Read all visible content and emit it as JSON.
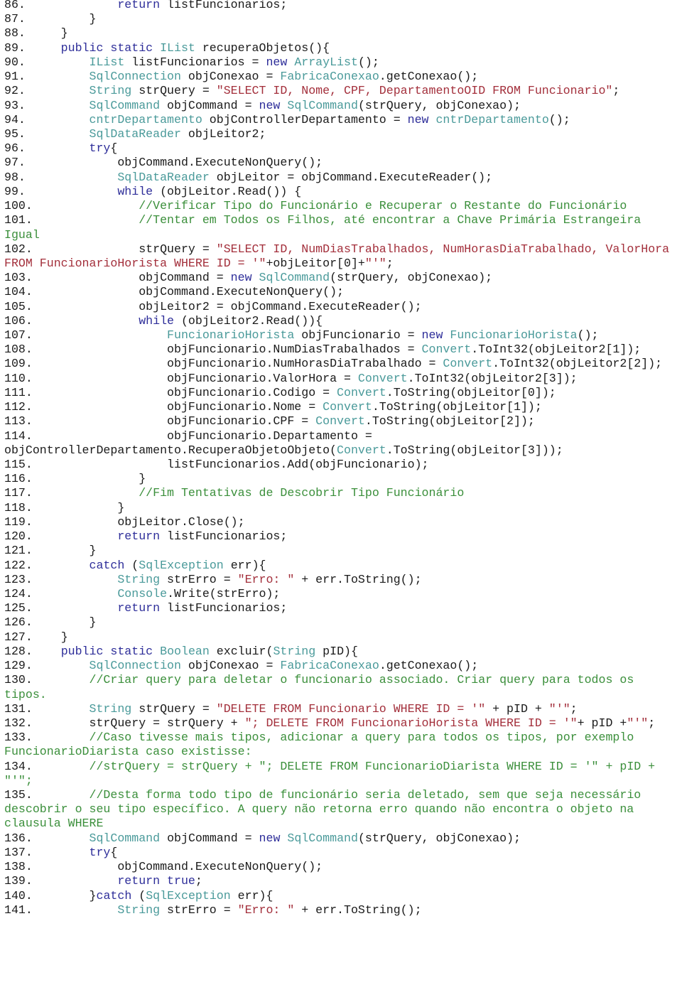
{
  "document": {
    "kind": "code-listing",
    "language": "C#",
    "token_colors": {
      "keyword": "#2d2d99",
      "type": "#4a9a9a",
      "string": "#a32f3b",
      "comment": "#3b8f3b",
      "plain": "#1a1a1a"
    },
    "lines": [
      {
        "n": "86.",
        "indent": 12,
        "tokens": [
          [
            "kw",
            "return"
          ],
          [
            "pl",
            " listFuncionarios;"
          ]
        ]
      },
      {
        "n": "87.",
        "indent": 8,
        "tokens": [
          [
            "pl",
            "}"
          ]
        ]
      },
      {
        "n": "88.",
        "indent": 4,
        "tokens": [
          [
            "pl",
            "}"
          ]
        ]
      },
      {
        "n": "89.",
        "indent": 4,
        "tokens": [
          [
            "kw",
            "public static"
          ],
          [
            "pl",
            " "
          ],
          [
            "ty",
            "IList"
          ],
          [
            "pl",
            " recuperaObjetos(){"
          ]
        ]
      },
      {
        "n": "90.",
        "indent": 8,
        "tokens": [
          [
            "ty",
            "IList"
          ],
          [
            "pl",
            " listFuncionarios = "
          ],
          [
            "kw",
            "new"
          ],
          [
            "pl",
            " "
          ],
          [
            "ty",
            "ArrayList"
          ],
          [
            "pl",
            "();"
          ]
        ]
      },
      {
        "n": "91.",
        "indent": 8,
        "tokens": [
          [
            "ty",
            "SqlConnection"
          ],
          [
            "pl",
            " objConexao = "
          ],
          [
            "ty",
            "FabricaConexao"
          ],
          [
            "pl",
            ".getConexao();"
          ]
        ]
      },
      {
        "n": "92.",
        "indent": 8,
        "tokens": [
          [
            "ty",
            "String"
          ],
          [
            "pl",
            " strQuery = "
          ],
          [
            "str",
            "\"SELECT ID, Nome, CPF, DepartamentoOID FROM Funcionario\""
          ],
          [
            "pl",
            ";"
          ]
        ]
      },
      {
        "n": "93.",
        "indent": 8,
        "tokens": [
          [
            "ty",
            "SqlCommand"
          ],
          [
            "pl",
            " objCommand = "
          ],
          [
            "kw",
            "new"
          ],
          [
            "pl",
            " "
          ],
          [
            "ty",
            "SqlCommand"
          ],
          [
            "pl",
            "(strQuery, objConexao);"
          ]
        ]
      },
      {
        "n": "94.",
        "indent": 8,
        "tokens": [
          [
            "ty",
            "cntrDepartamento"
          ],
          [
            "pl",
            " objControllerDepartamento = "
          ],
          [
            "kw",
            "new"
          ],
          [
            "pl",
            " "
          ],
          [
            "ty",
            "cntrDepartamento"
          ],
          [
            "pl",
            "();"
          ]
        ]
      },
      {
        "n": "95.",
        "indent": 8,
        "tokens": [
          [
            "ty",
            "SqlDataReader"
          ],
          [
            "pl",
            " objLeitor2;"
          ]
        ]
      },
      {
        "n": "96.",
        "indent": 8,
        "tokens": [
          [
            "kw",
            "try"
          ],
          [
            "pl",
            "{"
          ]
        ]
      },
      {
        "n": "97.",
        "indent": 12,
        "tokens": [
          [
            "pl",
            "objCommand.ExecuteNonQuery();"
          ]
        ]
      },
      {
        "n": "98.",
        "indent": 12,
        "tokens": [
          [
            "ty",
            "SqlDataReader"
          ],
          [
            "pl",
            " objLeitor = objCommand.ExecuteReader();"
          ]
        ]
      },
      {
        "n": "99.",
        "indent": 12,
        "tokens": [
          [
            "kw",
            "while"
          ],
          [
            "pl",
            " (objLeitor.Read()) {"
          ]
        ]
      },
      {
        "n": "100.",
        "indent": 15,
        "tokens": [
          [
            "cm",
            "//Verificar Tipo do Funcionário e Recuperar o Restante do Funcionário"
          ]
        ]
      },
      {
        "n": "101.",
        "indent": 15,
        "tokens": [
          [
            "cm",
            "//Tentar em Todos os Filhos, até encontrar a Chave Primária Estrangeira Igual"
          ]
        ]
      },
      {
        "n": "102.",
        "indent": 15,
        "tokens": [
          [
            "pl",
            "strQuery = "
          ],
          [
            "str",
            "\"SELECT ID, NumDiasTrabalhados, NumHorasDiaTrabalhado, ValorHora FROM FuncionarioHorista WHERE ID = '\""
          ],
          [
            "pl",
            "+objLeitor[0]+"
          ],
          [
            "str",
            "\"'\""
          ],
          [
            "pl",
            ";"
          ]
        ]
      },
      {
        "n": "103.",
        "indent": 15,
        "tokens": [
          [
            "pl",
            "objCommand = "
          ],
          [
            "kw",
            "new"
          ],
          [
            "pl",
            " "
          ],
          [
            "ty",
            "SqlCommand"
          ],
          [
            "pl",
            "(strQuery, objConexao);"
          ]
        ]
      },
      {
        "n": "104.",
        "indent": 15,
        "tokens": [
          [
            "pl",
            "objCommand.ExecuteNonQuery();"
          ]
        ]
      },
      {
        "n": "105.",
        "indent": 15,
        "tokens": [
          [
            "pl",
            "objLeitor2 = objCommand.ExecuteReader();"
          ]
        ]
      },
      {
        "n": "106.",
        "indent": 15,
        "tokens": [
          [
            "kw",
            "while"
          ],
          [
            "pl",
            " (objLeitor2.Read()){"
          ]
        ]
      },
      {
        "n": "107.",
        "indent": 19,
        "tokens": [
          [
            "ty",
            "FuncionarioHorista"
          ],
          [
            "pl",
            " objFuncionario = "
          ],
          [
            "kw",
            "new"
          ],
          [
            "pl",
            " "
          ],
          [
            "ty",
            "FuncionarioHorista"
          ],
          [
            "pl",
            "();"
          ]
        ]
      },
      {
        "n": "108.",
        "indent": 19,
        "tokens": [
          [
            "pl",
            "objFuncionario.NumDiasTrabalhados = "
          ],
          [
            "ty",
            "Convert"
          ],
          [
            "pl",
            ".ToInt32(objLeitor2[1]);"
          ]
        ]
      },
      {
        "n": "109.",
        "indent": 19,
        "tokens": [
          [
            "pl",
            "objFuncionario.NumHorasDiaTrabalhado = "
          ],
          [
            "ty",
            "Convert"
          ],
          [
            "pl",
            ".ToInt32(objLeitor2[2]);"
          ]
        ]
      },
      {
        "n": "110.",
        "indent": 19,
        "tokens": [
          [
            "pl",
            "objFuncionario.ValorHora = "
          ],
          [
            "ty",
            "Convert"
          ],
          [
            "pl",
            ".ToInt32(objLeitor2[3]);"
          ]
        ]
      },
      {
        "n": "111.",
        "indent": 19,
        "tokens": [
          [
            "pl",
            "objFuncionario.Codigo = "
          ],
          [
            "ty",
            "Convert"
          ],
          [
            "pl",
            ".ToString(objLeitor[0]);"
          ]
        ]
      },
      {
        "n": "112.",
        "indent": 19,
        "tokens": [
          [
            "pl",
            "objFuncionario.Nome = "
          ],
          [
            "ty",
            "Convert"
          ],
          [
            "pl",
            ".ToString(objLeitor[1]);"
          ]
        ]
      },
      {
        "n": "113.",
        "indent": 19,
        "tokens": [
          [
            "pl",
            "objFuncionario.CPF = "
          ],
          [
            "ty",
            "Convert"
          ],
          [
            "pl",
            ".ToString(objLeitor[2]);"
          ]
        ]
      },
      {
        "n": "114.",
        "indent": 19,
        "tokens": [
          [
            "pl",
            "objFuncionario.Departamento = objControllerDepartamento.RecuperaObjetoObjeto("
          ],
          [
            "ty",
            "Convert"
          ],
          [
            "pl",
            ".ToString(objLeitor[3]));"
          ]
        ]
      },
      {
        "n": "115.",
        "indent": 19,
        "tokens": [
          [
            "pl",
            "listFuncionarios.Add(objFuncionario);"
          ]
        ]
      },
      {
        "n": "116.",
        "indent": 15,
        "tokens": [
          [
            "pl",
            "}"
          ]
        ]
      },
      {
        "n": "117.",
        "indent": 15,
        "tokens": [
          [
            "cm",
            "//Fim Tentativas de Descobrir Tipo Funcionário"
          ]
        ]
      },
      {
        "n": "118.",
        "indent": 12,
        "tokens": [
          [
            "pl",
            "}"
          ]
        ]
      },
      {
        "n": "119.",
        "indent": 12,
        "tokens": [
          [
            "pl",
            "objLeitor.Close();"
          ]
        ]
      },
      {
        "n": "120.",
        "indent": 12,
        "tokens": [
          [
            "kw",
            "return"
          ],
          [
            "pl",
            " listFuncionarios;"
          ]
        ]
      },
      {
        "n": "121.",
        "indent": 8,
        "tokens": [
          [
            "pl",
            "}"
          ]
        ]
      },
      {
        "n": "122.",
        "indent": 8,
        "tokens": [
          [
            "kw",
            "catch"
          ],
          [
            "pl",
            " ("
          ],
          [
            "ty",
            "SqlException"
          ],
          [
            "pl",
            " err){"
          ]
        ]
      },
      {
        "n": "123.",
        "indent": 12,
        "tokens": [
          [
            "ty",
            "String"
          ],
          [
            "pl",
            " strErro = "
          ],
          [
            "str",
            "\"Erro: \""
          ],
          [
            "pl",
            " + err.ToString();"
          ]
        ]
      },
      {
        "n": "124.",
        "indent": 12,
        "tokens": [
          [
            "ty",
            "Console"
          ],
          [
            "pl",
            ".Write(strErro);"
          ]
        ]
      },
      {
        "n": "125.",
        "indent": 12,
        "tokens": [
          [
            "kw",
            "return"
          ],
          [
            "pl",
            " listFuncionarios;"
          ]
        ]
      },
      {
        "n": "126.",
        "indent": 8,
        "tokens": [
          [
            "pl",
            "}"
          ]
        ]
      },
      {
        "n": "127.",
        "indent": 4,
        "tokens": [
          [
            "pl",
            "}"
          ]
        ]
      },
      {
        "n": "128.",
        "indent": 4,
        "tokens": [
          [
            "kw",
            "public static"
          ],
          [
            "pl",
            " "
          ],
          [
            "ty",
            "Boolean"
          ],
          [
            "pl",
            " excluir("
          ],
          [
            "ty",
            "String"
          ],
          [
            "pl",
            " pID){"
          ]
        ]
      },
      {
        "n": "129.",
        "indent": 8,
        "tokens": [
          [
            "ty",
            "SqlConnection"
          ],
          [
            "pl",
            " objConexao = "
          ],
          [
            "ty",
            "FabricaConexao"
          ],
          [
            "pl",
            ".getConexao();"
          ]
        ]
      },
      {
        "n": "130.",
        "indent": 8,
        "tokens": [
          [
            "cm",
            "//Criar query para deletar o funcionario associado. Criar query para todos os tipos."
          ]
        ]
      },
      {
        "n": "131.",
        "indent": 8,
        "tokens": [
          [
            "ty",
            "String"
          ],
          [
            "pl",
            " strQuery = "
          ],
          [
            "str",
            "\"DELETE FROM Funcionario WHERE ID = '\""
          ],
          [
            "pl",
            " + pID + "
          ],
          [
            "str",
            "\"'\""
          ],
          [
            "pl",
            ";"
          ]
        ]
      },
      {
        "n": "132.",
        "indent": 8,
        "tokens": [
          [
            "pl",
            "strQuery = strQuery + "
          ],
          [
            "str",
            "\"; DELETE FROM FuncionarioHorista WHERE ID = '\""
          ],
          [
            "pl",
            "+ pID +"
          ],
          [
            "str",
            "\"'\""
          ],
          [
            "pl",
            ";"
          ]
        ]
      },
      {
        "n": "133.",
        "indent": 8,
        "tokens": [
          [
            "cm",
            "//Caso tivesse mais tipos, adicionar a query para todos os tipos, por exemplo FuncionarioDiarista caso existisse:"
          ]
        ]
      },
      {
        "n": "134.",
        "indent": 8,
        "tokens": [
          [
            "cm",
            "//strQuery = strQuery + \"; DELETE FROM FuncionarioDiarista WHERE ID = '\" + pID + \"'\";"
          ]
        ]
      },
      {
        "n": "135.",
        "indent": 8,
        "tokens": [
          [
            "cm",
            "//Desta forma todo tipo de funcionário seria deletado, sem que seja necessário descobrir o seu tipo específico. A query não retorna erro quando não encontra o objeto na clausula WHERE"
          ]
        ]
      },
      {
        "n": "136.",
        "indent": 8,
        "tokens": [
          [
            "ty",
            "SqlCommand"
          ],
          [
            "pl",
            " objCommand = "
          ],
          [
            "kw",
            "new"
          ],
          [
            "pl",
            " "
          ],
          [
            "ty",
            "SqlCommand"
          ],
          [
            "pl",
            "(strQuery, objConexao);"
          ]
        ]
      },
      {
        "n": "137.",
        "indent": 8,
        "tokens": [
          [
            "kw",
            "try"
          ],
          [
            "pl",
            "{"
          ]
        ]
      },
      {
        "n": "138.",
        "indent": 12,
        "tokens": [
          [
            "pl",
            "objCommand.ExecuteNonQuery();"
          ]
        ]
      },
      {
        "n": "139.",
        "indent": 12,
        "tokens": [
          [
            "kw",
            "return true"
          ],
          [
            "pl",
            ";"
          ]
        ]
      },
      {
        "n": "140.",
        "indent": 8,
        "tokens": [
          [
            "pl",
            "}"
          ],
          [
            "kw",
            "catch"
          ],
          [
            "pl",
            " ("
          ],
          [
            "ty",
            "SqlException"
          ],
          [
            "pl",
            " err){"
          ]
        ]
      },
      {
        "n": "141.",
        "indent": 12,
        "tokens": [
          [
            "ty",
            "String"
          ],
          [
            "pl",
            " strErro = "
          ],
          [
            "str",
            "\"Erro: \""
          ],
          [
            "pl",
            " + err.ToString();"
          ]
        ]
      }
    ]
  }
}
